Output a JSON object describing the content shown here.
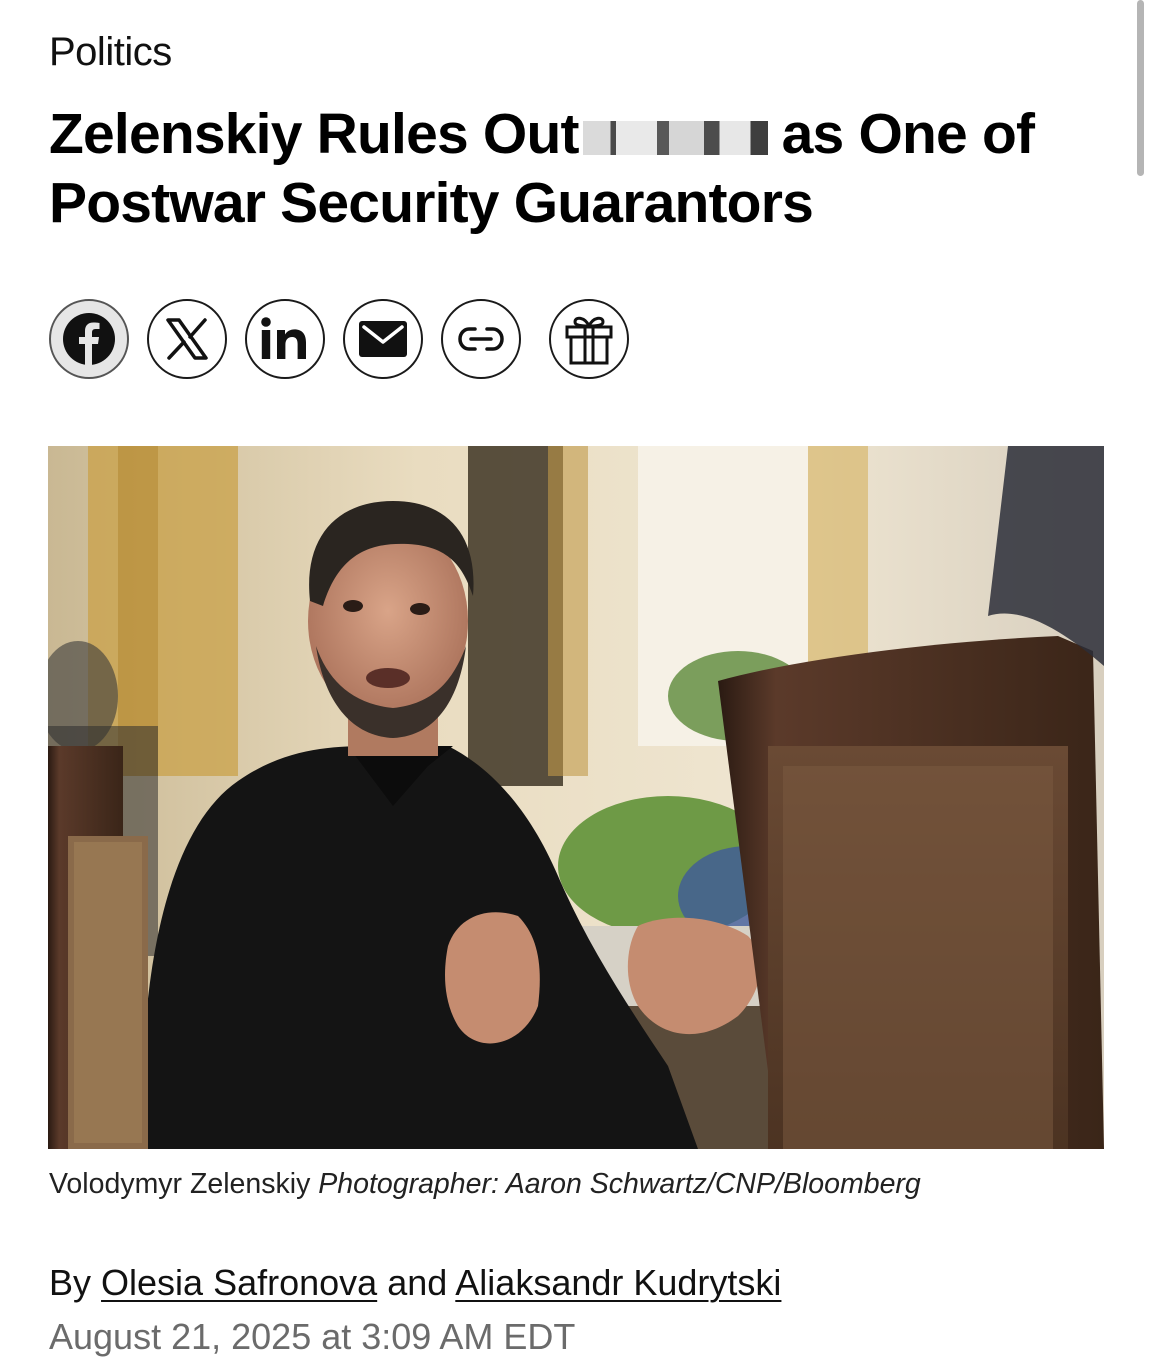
{
  "article": {
    "section": "Politics",
    "headline_before": "Zelenskiy Rules Out",
    "headline_after": "as One of Postwar Security Guarantors",
    "share_buttons": [
      {
        "name": "facebook",
        "icon": "facebook-icon"
      },
      {
        "name": "x",
        "icon": "x-icon"
      },
      {
        "name": "linkedin",
        "icon": "linkedin-icon"
      },
      {
        "name": "email",
        "icon": "mail-icon"
      },
      {
        "name": "copy-link",
        "icon": "link-icon"
      },
      {
        "name": "gift",
        "icon": "gift-icon"
      }
    ],
    "caption_subject": "Volodymyr Zelenskiy",
    "caption_credit": "Photographer: Aaron Schwartz/CNP/Bloomberg",
    "byline_prefix": "By",
    "author_1": "Olesia Safronova",
    "byline_and": "and",
    "author_2": "Aliaksandr Kudrytski",
    "date": "August 21, 2025 at 3:09 AM EDT"
  }
}
